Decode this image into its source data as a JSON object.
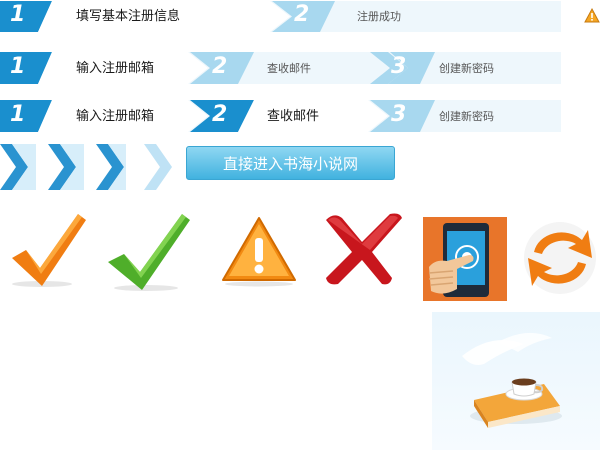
{
  "steps_basic": {
    "step1_num": "1",
    "step1_label": "填写基本注册信息",
    "step2_num": "2",
    "step2_label": "注册成功"
  },
  "steps_email_a": {
    "step1_num": "1",
    "step1_label": "输入注册邮箱",
    "step2_num": "2",
    "step2_label": "查收邮件",
    "step3_num": "3",
    "step3_label": "创建新密码"
  },
  "steps_email_b": {
    "step1_num": "1",
    "step1_label": "输入注册邮箱",
    "step2_num": "2",
    "step2_label": "查收邮件",
    "step3_num": "3",
    "step3_label": "创建新密码"
  },
  "enter_button_label": "直接进入书海小说网",
  "icons": [
    "warning-small-icon",
    "orange-check-icon",
    "green-check-icon",
    "warning-icon",
    "red-cross-icon",
    "phone-touch-icon",
    "refresh-icon",
    "coffee-book-illustration"
  ],
  "colors": {
    "step_active": "#1a8fce",
    "step_inactive": "#a8d8ef",
    "step_bg": "#eef7fc",
    "button": "#41b2df"
  }
}
